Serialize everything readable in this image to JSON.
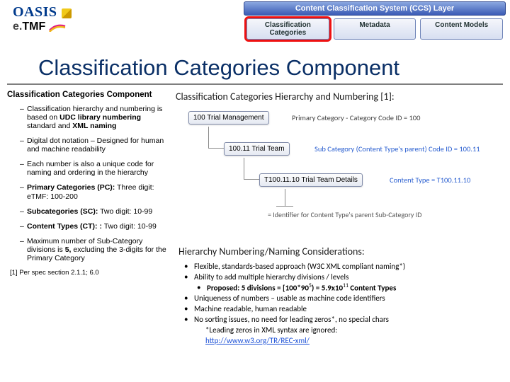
{
  "header": {
    "logo_oasis": "OASIS",
    "logo_etmf_e": "e.",
    "logo_etmf_tmf": "TMF",
    "ccs_layer": "Content Classification System (CCS) Layer",
    "tabs": {
      "t1": "Classification Categories",
      "t2": "Metadata",
      "t3": "Content Models"
    }
  },
  "title": "Classification Categories Component",
  "left": {
    "heading": "Classification Categories Component",
    "b1_a": "Classification hierarchy and numbering is based on ",
    "b1_b": "UDC library numbering",
    "b1_c": " standard and ",
    "b1_d": "XML naming",
    "b2": "Digital dot notation – Designed for human and machine readability",
    "b3": "Each number is also a unique code for naming and ordering in the hierarchy",
    "b4_a": "Primary Categories (PC):",
    "b4_b": " Three digit:  eTMF: 100-200",
    "b5_a": "Subcategories (SC):",
    "b5_b": " Two digit:   10-99",
    "b6_a": "Content Types (CT):    :",
    "b6_b": " Two digit:   10-99",
    "b7_a": "Maximum number of Sub-Category divisions is ",
    "b7_b": "5,",
    "b7_c": " excluding the 3-digits for the Primary Category",
    "footnote": "[1] Per spec section 2.1.1; 6.0"
  },
  "right": {
    "heading": "Classification Categories Hierarchy and Numbering [1]:",
    "diagram": {
      "n1": "100 Trial Management",
      "c1": "Primary Category - Category Code ID = 100",
      "n2": "100.11 Trial Team",
      "c2": "Sub Category (Content Type's parent)  Code ID = 100.11",
      "n3": "T100.11.10 Trial Team Details",
      "c3": "Content Type = T100.11.10",
      "u1": "= Identifier for Content Type's parent Sub-Category ID"
    },
    "sec2_heading": "Hierarchy Numbering/Naming Considerations:",
    "cons": {
      "c1": "Flexible, standards-based approach (W3C XML compliant naming*)",
      "c2": "Ability to add multiple hierarchy divisions / levels",
      "c2s_a": "Proposed:  5 divisions = [100*90",
      "c2s_b": ") = 5.9x10",
      "c2s_c": " Content Types",
      "c3": "Uniqueness of numbers – usable as machine code identifiers",
      "c4": "Machine readable, human readable",
      "c5": "No sorting issues, no need for leading zeros*, no special chars",
      "note": "*Leading zeros in XML syntax are ignored:",
      "link": "http://www.w3.org/TR/REC-xml/"
    }
  }
}
